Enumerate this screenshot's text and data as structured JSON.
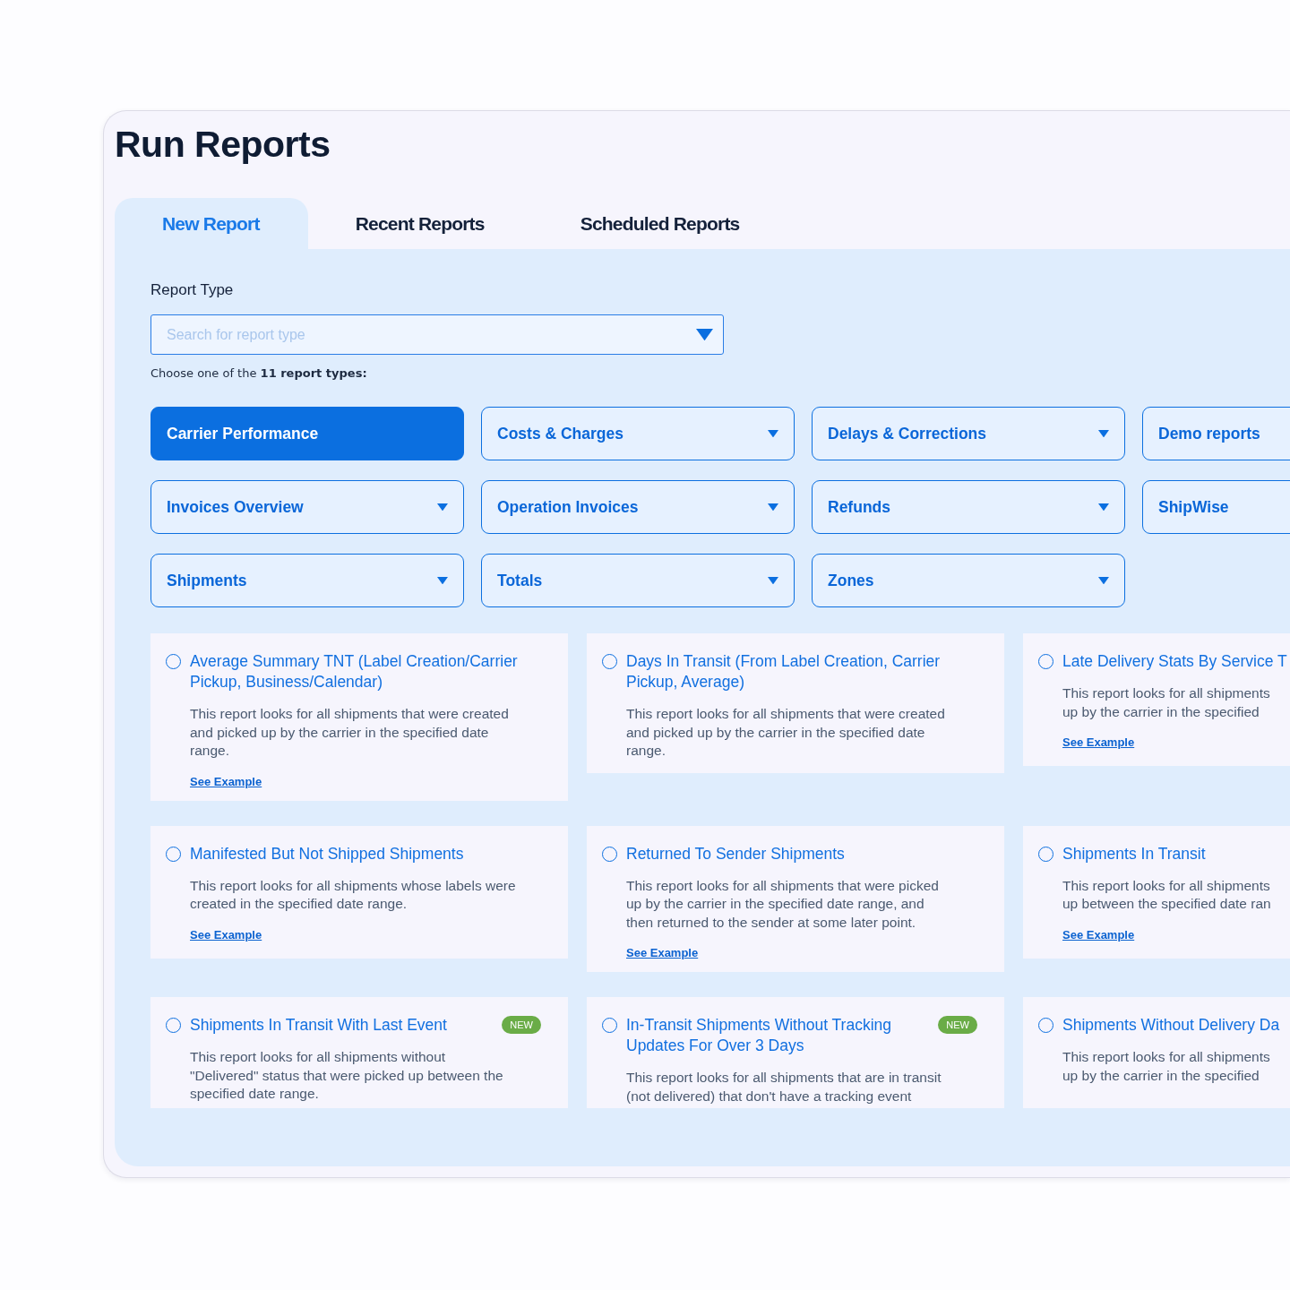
{
  "title": "Run Reports",
  "tabs": [
    {
      "label": "New Report",
      "selected": true
    },
    {
      "label": "Recent Reports",
      "selected": false
    },
    {
      "label": "Scheduled Reports",
      "selected": false
    }
  ],
  "report_type": {
    "label": "Report Type",
    "placeholder": "Search for report type",
    "hint": "Choose one of the **11 report types:**"
  },
  "categories": [
    {
      "label": "Carrier Performance",
      "selected": true,
      "caret": false
    },
    {
      "label": "Costs & Charges",
      "selected": false,
      "caret": true
    },
    {
      "label": "Delays & Corrections",
      "selected": false,
      "caret": true
    },
    {
      "label": "Demo reports",
      "selected": false
    },
    {
      "label": "Invoices Overview",
      "selected": false,
      "caret": true
    },
    {
      "label": "Operation Invoices",
      "selected": false,
      "caret": true
    },
    {
      "label": "Refunds",
      "selected": false,
      "caret": true
    },
    {
      "label": "ShipWise",
      "selected": false
    },
    {
      "label": "Shipments",
      "selected": false,
      "caret": true
    },
    {
      "label": "Totals",
      "selected": false,
      "caret": true
    },
    {
      "label": "Zones",
      "selected": false,
      "caret": true
    }
  ],
  "reports": [
    {
      "title": "Average Summary TNT (Label Creation/Carrier Pickup, Business/Calendar)",
      "selected": false,
      "description_lines": [
        "This report looks for all shipments that were created",
        "and picked up by the carrier in the specified date",
        "range."
      ],
      "link": "See Example"
    },
    {
      "title": "Days In Transit (From Label Creation, Carrier Pickup, Average)",
      "selected": false,
      "description_lines": [
        "This report looks for all shipments that were created",
        "and picked up by the carrier in the specified date",
        "range."
      ]
    },
    {
      "title": "Late Delivery Stats By Service T",
      "selected": false,
      "description_lines": [
        "This report looks for all shipments",
        "up by the carrier in the specified"
      ],
      "link": "See Example"
    },
    {
      "title": "Manifested But Not Shipped Shipments",
      "selected": false,
      "description_lines": [
        "This report looks for all shipments whose labels were",
        "created in the specified date range."
      ],
      "link": "See Example"
    },
    {
      "title": "Returned To Sender Shipments",
      "selected": false,
      "description_lines": [
        "This report looks for all shipments that were picked",
        "up by the carrier in the specified date range, and",
        "then returned to the sender at some later point."
      ],
      "link": "See Example"
    },
    {
      "title": "Shipments In Transit",
      "selected": false,
      "description_lines": [
        "This report looks for all shipments",
        "up between the specified date ran"
      ],
      "link": "See Example"
    },
    {
      "title": "Shipments In Transit With Last Event",
      "selected": false,
      "badge": "NEW",
      "description_lines": [
        "This report looks for all shipments without",
        "\"Delivered\" status that were picked up between the",
        "specified date range."
      ]
    },
    {
      "title": "In-Transit Shipments Without Tracking Updates For Over 3 Days",
      "selected": false,
      "badge": "NEW",
      "description_lines": [
        "This report looks for all shipments that are in transit",
        "(not delivered) that don't have a tracking event"
      ]
    },
    {
      "title": "Shipments Without Delivery Da",
      "selected": false,
      "description_lines": [
        "This report looks for all shipments",
        "up by the carrier in the specified"
      ]
    }
  ]
}
